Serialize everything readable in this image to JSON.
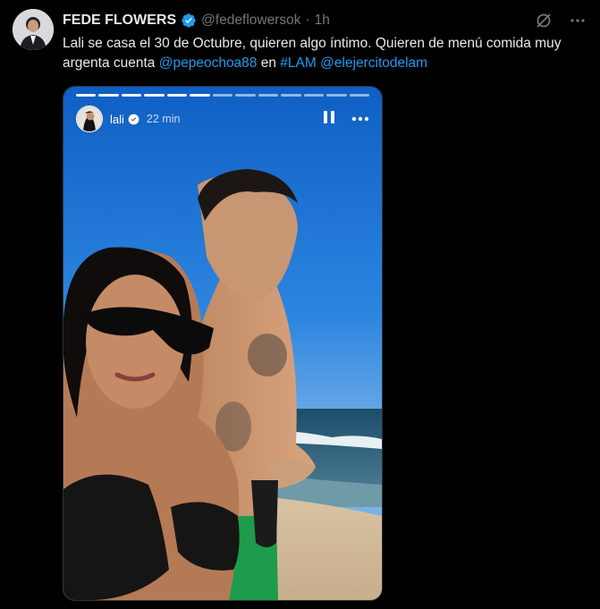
{
  "author": {
    "name": "FEDE FLOWERS",
    "handle": "@fedeflowersok",
    "separator": "·",
    "time": "1h"
  },
  "tweet": {
    "text_before": "Lali se casa el 30 de Octubre, quieren algo íntimo. Quieren de menú comida muy argenta cuenta ",
    "mention_1": "@pepeochoa88",
    "text_mid": " en ",
    "hashtag": "#LAM",
    "text_space": " ",
    "mention_2": "@elejercitodelam"
  },
  "story": {
    "user": "lali",
    "time": "22 min",
    "segments": 13,
    "active_segment": 6
  },
  "icons": {
    "verified": "verified-badge-icon",
    "grok": "grok-icon",
    "more": "more-icon",
    "pause": "pause-icon"
  },
  "colors": {
    "background": "#000000",
    "text": "#e7e9ea",
    "muted": "#71767b",
    "link": "#1d9bf0"
  }
}
